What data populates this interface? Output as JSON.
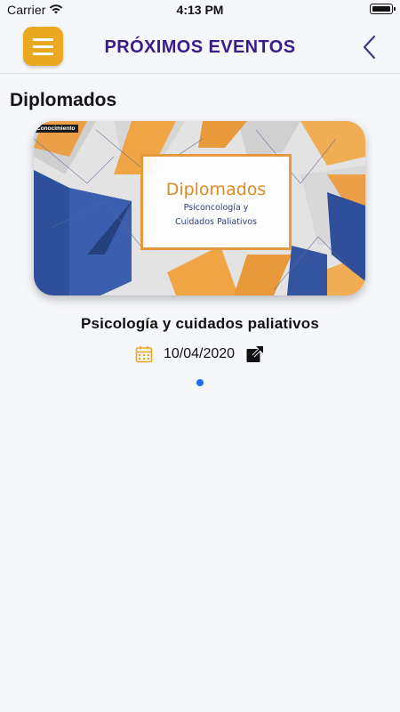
{
  "status_bar": {
    "carrier": "Carrier",
    "time": "4:13 PM"
  },
  "header": {
    "title": "PRÓXIMOS EVENTOS",
    "menu_icon": "hamburger-menu-icon",
    "back_icon": "chevron-left-icon",
    "accent_color": "#e9a81f",
    "title_color": "#3b1a8a"
  },
  "section": {
    "title": "Diplomados"
  },
  "event": {
    "image_tag": "Conocimiento",
    "banner_title": "Diplomados",
    "banner_subtitle_line1": "Psiconcología y",
    "banner_subtitle_line2": "Cuidados Paliativos",
    "name": "Psicología y cuidados paliativos",
    "date": "10/04/2020",
    "calendar_icon": "calendar-icon",
    "link_icon": "external-link-icon"
  },
  "pagination": {
    "active_color": "#1f6ef5"
  }
}
